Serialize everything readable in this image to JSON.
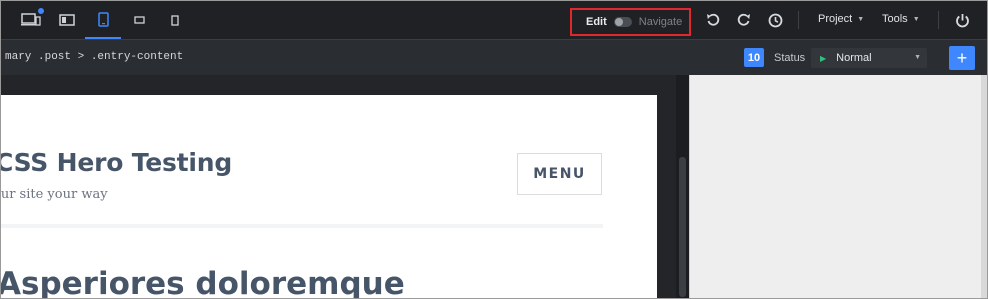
{
  "toolbar": {
    "devices": [
      {
        "name": "desktop-laptop",
        "active": false
      },
      {
        "name": "tablet-landscape",
        "active": false
      },
      {
        "name": "tablet-portrait",
        "active": true
      },
      {
        "name": "phone-landscape",
        "active": false
      },
      {
        "name": "phone-portrait",
        "active": false
      }
    ],
    "mode": {
      "edit_label": "Edit",
      "navigate_label": "Navigate"
    },
    "project_label": "Project",
    "tools_label": "Tools"
  },
  "selector_bar": {
    "path": "mary .post > .entry-content",
    "count": "10",
    "status_label": "Status",
    "status_value": "Normal",
    "add_label": "+"
  },
  "site": {
    "title": "CSS Hero Testing",
    "tagline": "our site your way",
    "menu_label": "MENU",
    "post_title": "Asperiores doloremque"
  },
  "colors": {
    "accent": "#3f87ff",
    "highlight": "#e0282f",
    "toolbar_bg": "#1f2124",
    "heading": "#475569"
  }
}
